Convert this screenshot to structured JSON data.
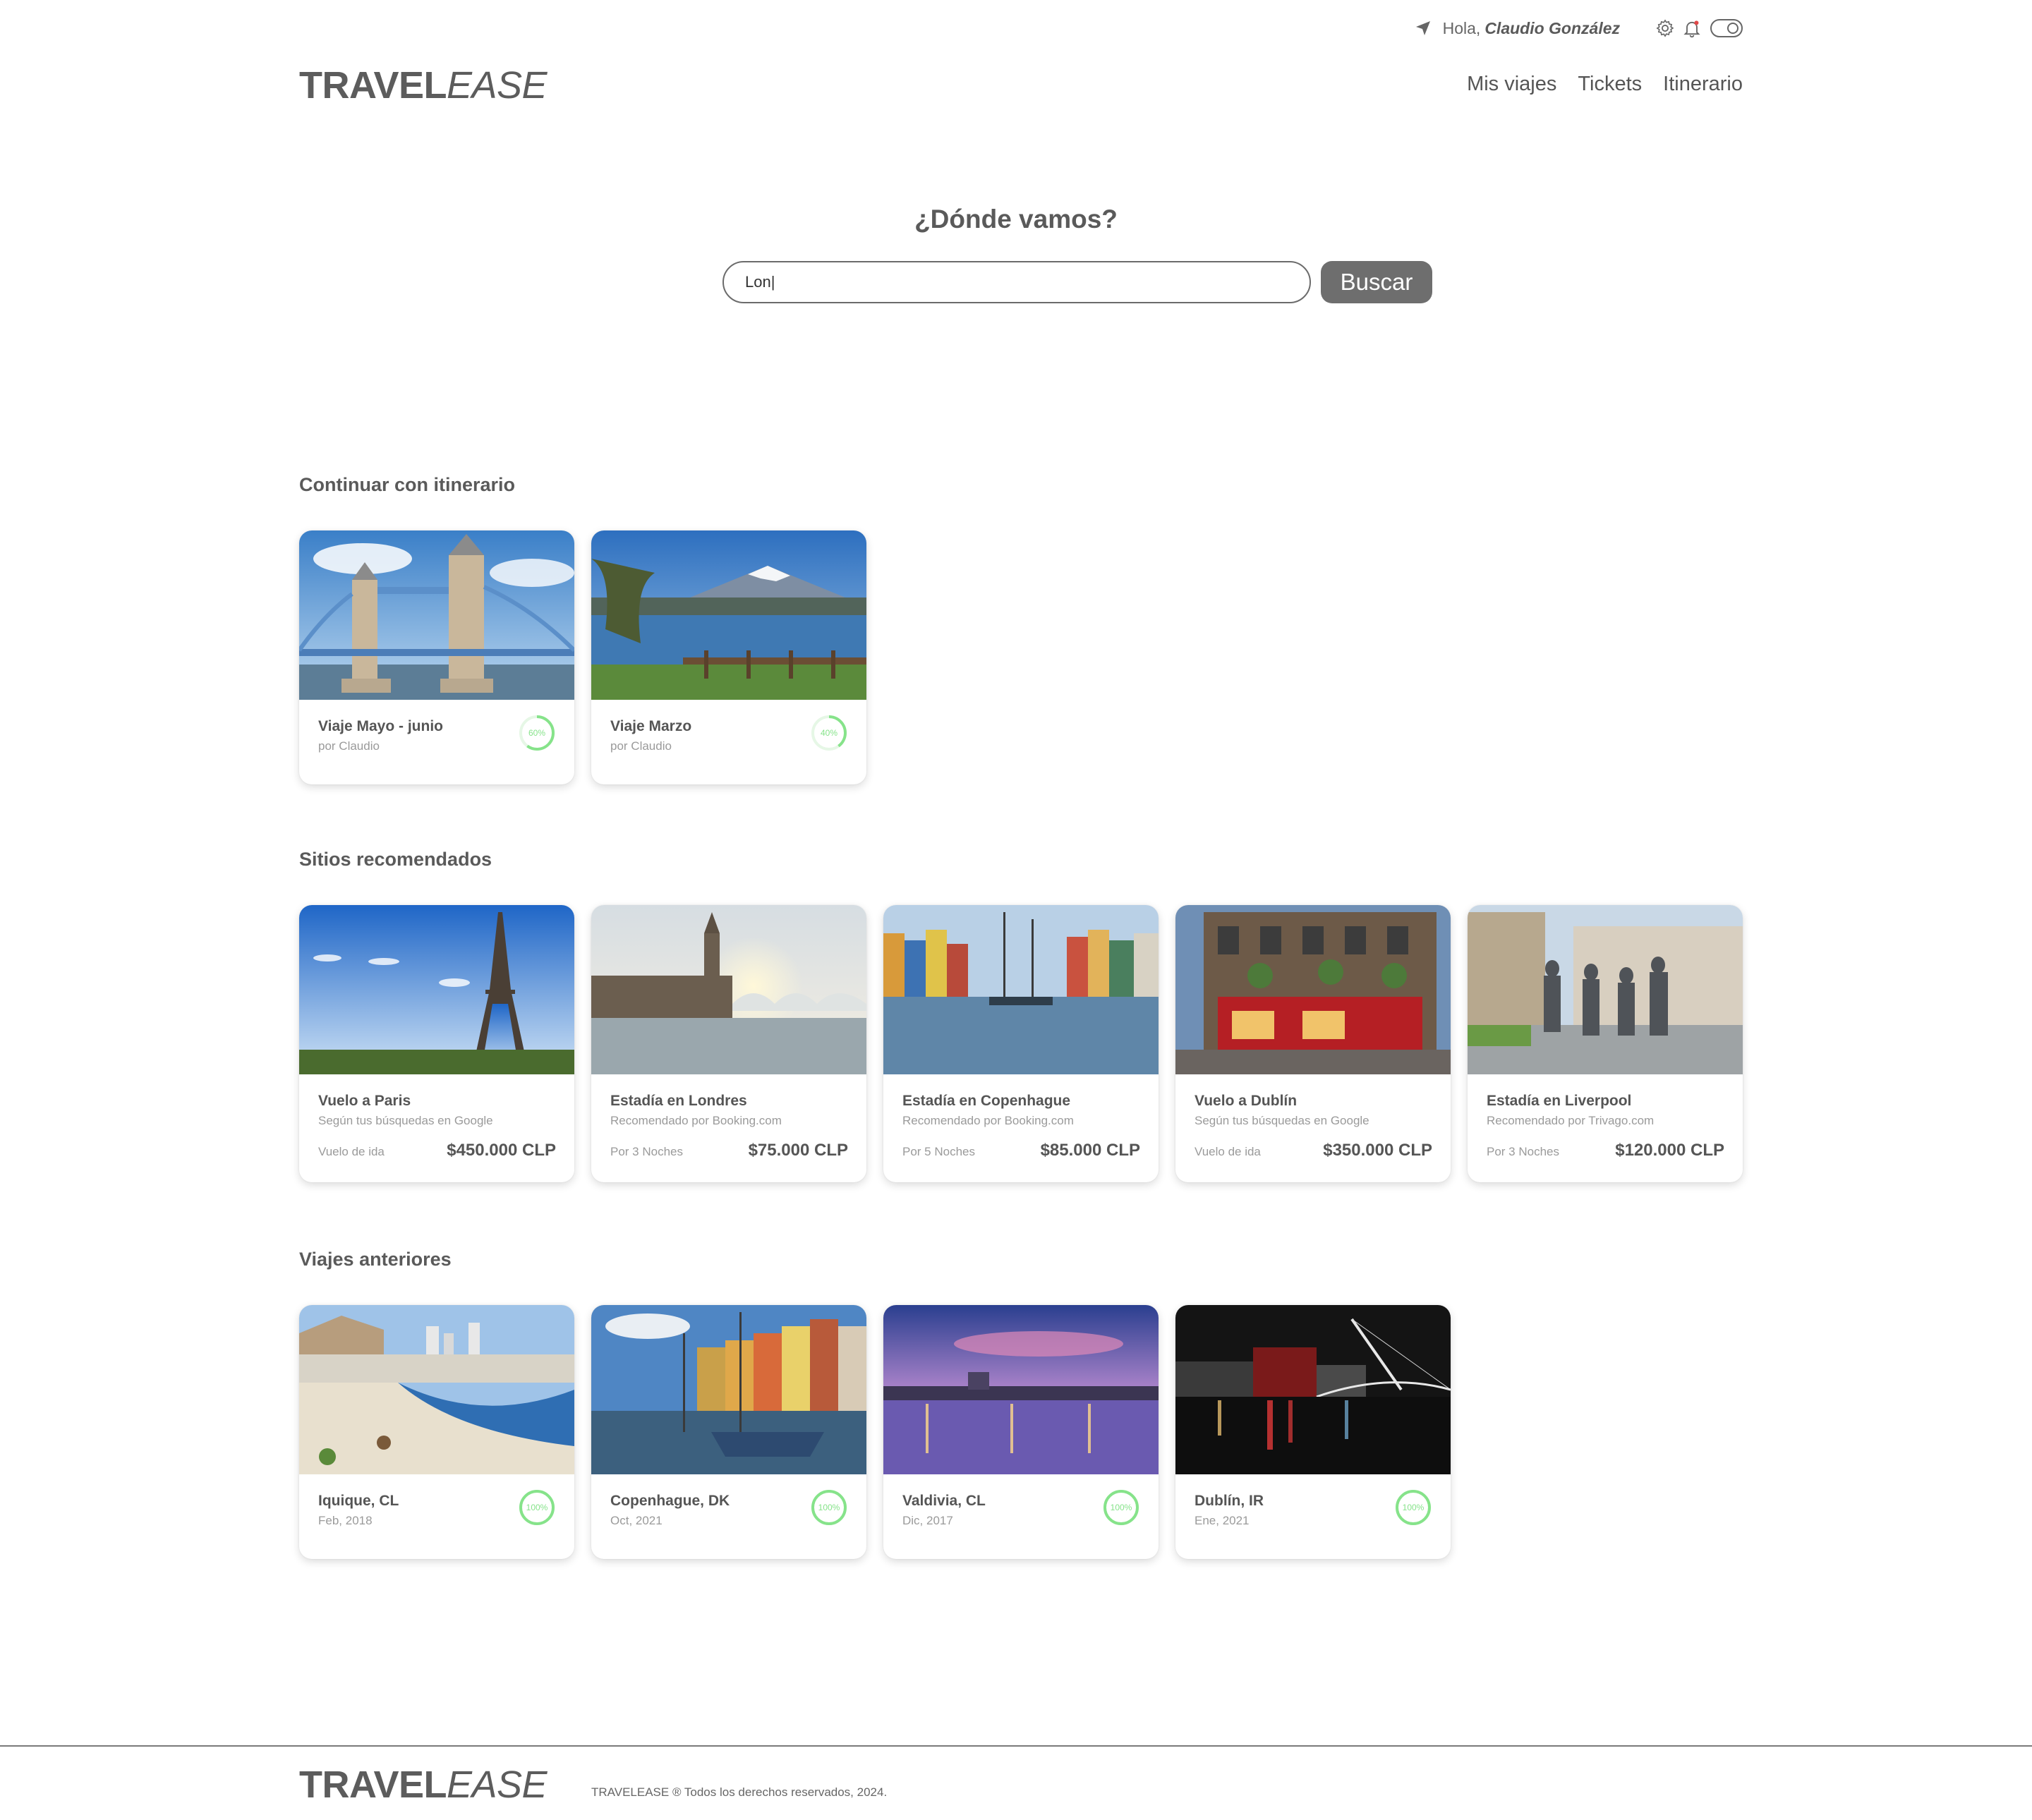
{
  "topbar": {
    "greeting": "Hola,",
    "user_name": "Claudio González",
    "icons": [
      "location-arrow-icon",
      "gear-icon",
      "bell-icon",
      "toggle-switch"
    ]
  },
  "header": {
    "logo_bold": "TRAVEL",
    "logo_italic": "EASE",
    "nav": [
      "Mis viajes",
      "Tickets",
      "Itinerario"
    ]
  },
  "search": {
    "title": "¿Dónde vamos?",
    "value": "Lon|",
    "button": "Buscar"
  },
  "sections": {
    "itinerary": {
      "title": "Continuar con itinerario",
      "cards": [
        {
          "title": "Viaje Mayo - junio",
          "subtitle": "por Claudio",
          "progress": 60,
          "progress_label": "60%",
          "image": "tower-bridge-london"
        },
        {
          "title": "Viaje Marzo",
          "subtitle": "por Claudio",
          "progress": 40,
          "progress_label": "40%",
          "image": "volcano-lake-chile"
        }
      ]
    },
    "recommended": {
      "title": "Sitios recomendados",
      "cards": [
        {
          "title": "Vuelo a Paris",
          "subtitle": "Según tus búsquedas en Google",
          "meta": "Vuelo de ida",
          "price": "$450.000 CLP",
          "image": "eiffel-tower"
        },
        {
          "title": "Estadía en Londres",
          "subtitle": "Recomendado por Booking.com",
          "meta": "Por 3 Noches",
          "price": "$75.000 CLP",
          "image": "big-ben-westminster"
        },
        {
          "title": "Estadía en Copenhague",
          "subtitle": "Recomendado por Booking.com",
          "meta": "Por 5 Noches",
          "price": "$85.000 CLP",
          "image": "nyhavn-copenhagen"
        },
        {
          "title": "Vuelo a Dublín",
          "subtitle": "Según tus búsquedas en Google",
          "meta": "Vuelo de ida",
          "price": "$350.000 CLP",
          "image": "temple-bar-dublin"
        },
        {
          "title": "Estadía en Liverpool",
          "subtitle": "Recomendado por Trivago.com",
          "meta": "Por 3 Noches",
          "price": "$120.000 CLP",
          "image": "beatles-statue-liverpool"
        }
      ]
    },
    "previous": {
      "title": "Viajes anteriores",
      "cards": [
        {
          "title": "Iquique, CL",
          "subtitle": "Feb, 2018",
          "progress": 100,
          "progress_label": "100%",
          "image": "iquique-beach"
        },
        {
          "title": "Copenhague, DK",
          "subtitle": "Oct, 2021",
          "progress": 100,
          "progress_label": "100%",
          "image": "copenhagen-harbor-boats"
        },
        {
          "title": "Valdivia, CL",
          "subtitle": "Dic, 2017",
          "progress": 100,
          "progress_label": "100%",
          "image": "valdivia-river-dusk"
        },
        {
          "title": "Dublín, IR",
          "subtitle": "Ene, 2021",
          "progress": 100,
          "progress_label": "100%",
          "image": "dublin-bridge-night"
        }
      ]
    }
  },
  "footer": {
    "logo_bold": "TRAVEL",
    "logo_italic": "EASE",
    "copyright": "TRAVELEASE ® Todos los derechos reservados, 2024."
  },
  "colors": {
    "text": "#5f5f5f",
    "button": "#6e6e6e",
    "progress_ring": "#86e38a",
    "muted": "#9a9a9a"
  }
}
